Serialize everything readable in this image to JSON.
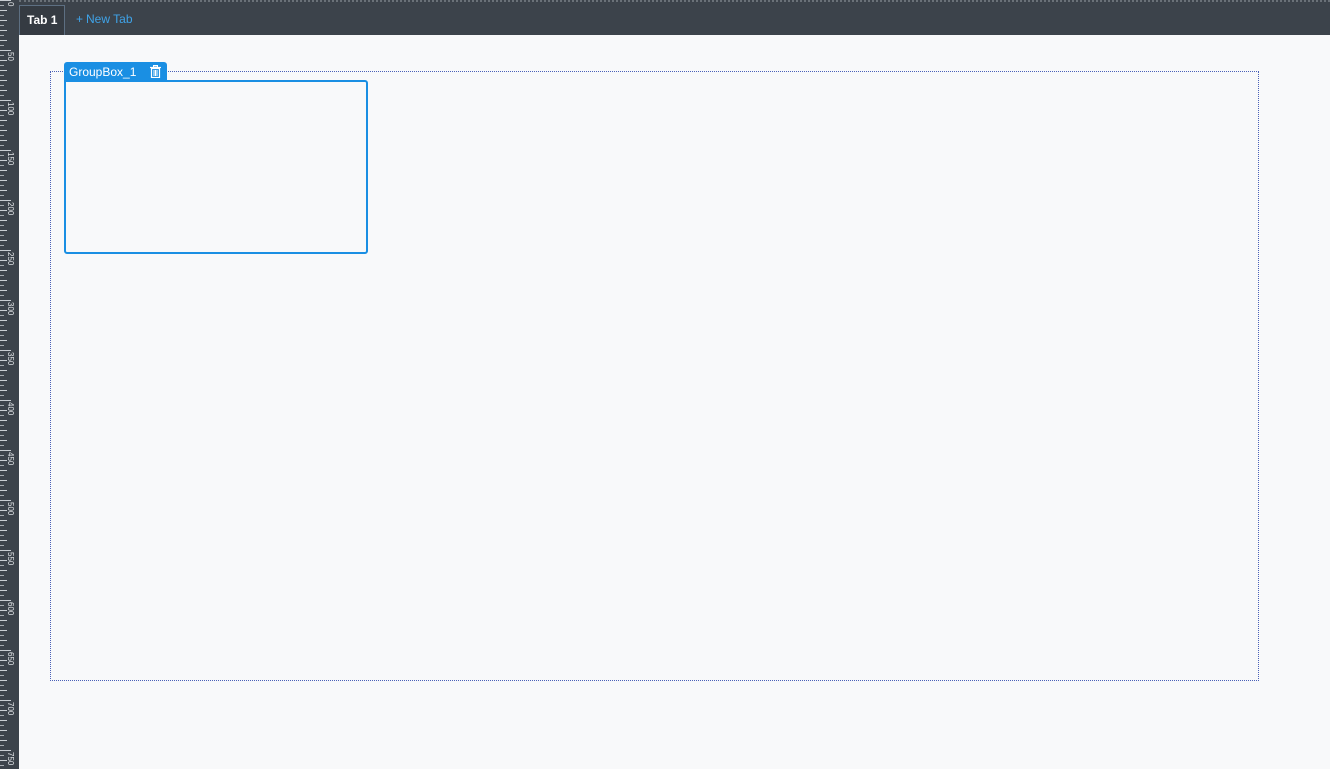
{
  "ruler": {
    "labels": [
      "0",
      "50",
      "100",
      "150",
      "200",
      "250",
      "300",
      "350",
      "400",
      "450",
      "500",
      "550",
      "600",
      "650",
      "700",
      "750"
    ]
  },
  "tabs": {
    "active_label": "Tab 1",
    "new_tab_label": "New Tab",
    "new_tab_symbol": "+"
  },
  "canvas": {
    "group_box": {
      "label": "GroupBox_1",
      "delete_icon": "trash-icon"
    }
  },
  "colors": {
    "accent": "#1a8fe3",
    "toolbar_bg": "#3c434b",
    "canvas_bg": "#f8f9fa",
    "new_tab_text": "#3fa3e8"
  }
}
